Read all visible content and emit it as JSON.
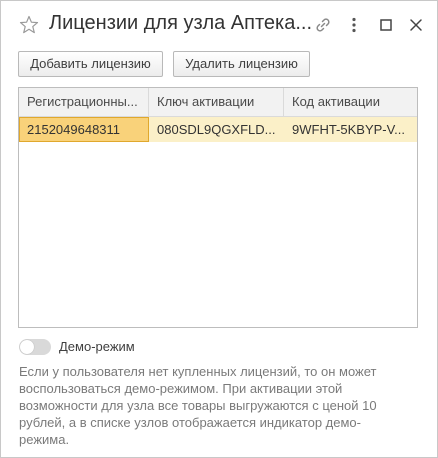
{
  "window": {
    "title": "Лицензии для узла Аптека..."
  },
  "toolbar": {
    "add_label": "Добавить лицензию",
    "delete_label": "Удалить лицензию"
  },
  "table": {
    "columns": [
      "Регистрационны...",
      "Ключ активации",
      "Код активации"
    ],
    "rows": [
      [
        "2152049648311",
        "080SDL9QGXFLD...",
        "9WFHT-5KBYP-V..."
      ]
    ],
    "selected_row_color": "#fbf0c8",
    "selected_cell_color": "#f9d27a"
  },
  "demo": {
    "label": "Демо-режим",
    "enabled": false,
    "hint": "Если у пользователя нет купленных лицензий, то он может воспользоваться демо-режимом. При активации этой возможности для узла все товары выгружаются с ценой 10 рублей, а в списке узлов отображается индикатор демо-режима."
  },
  "icons": {
    "favorite": "star-icon",
    "link": "link-icon",
    "more": "more-vertical-icon",
    "maximize": "maximize-icon",
    "close": "close-icon"
  }
}
